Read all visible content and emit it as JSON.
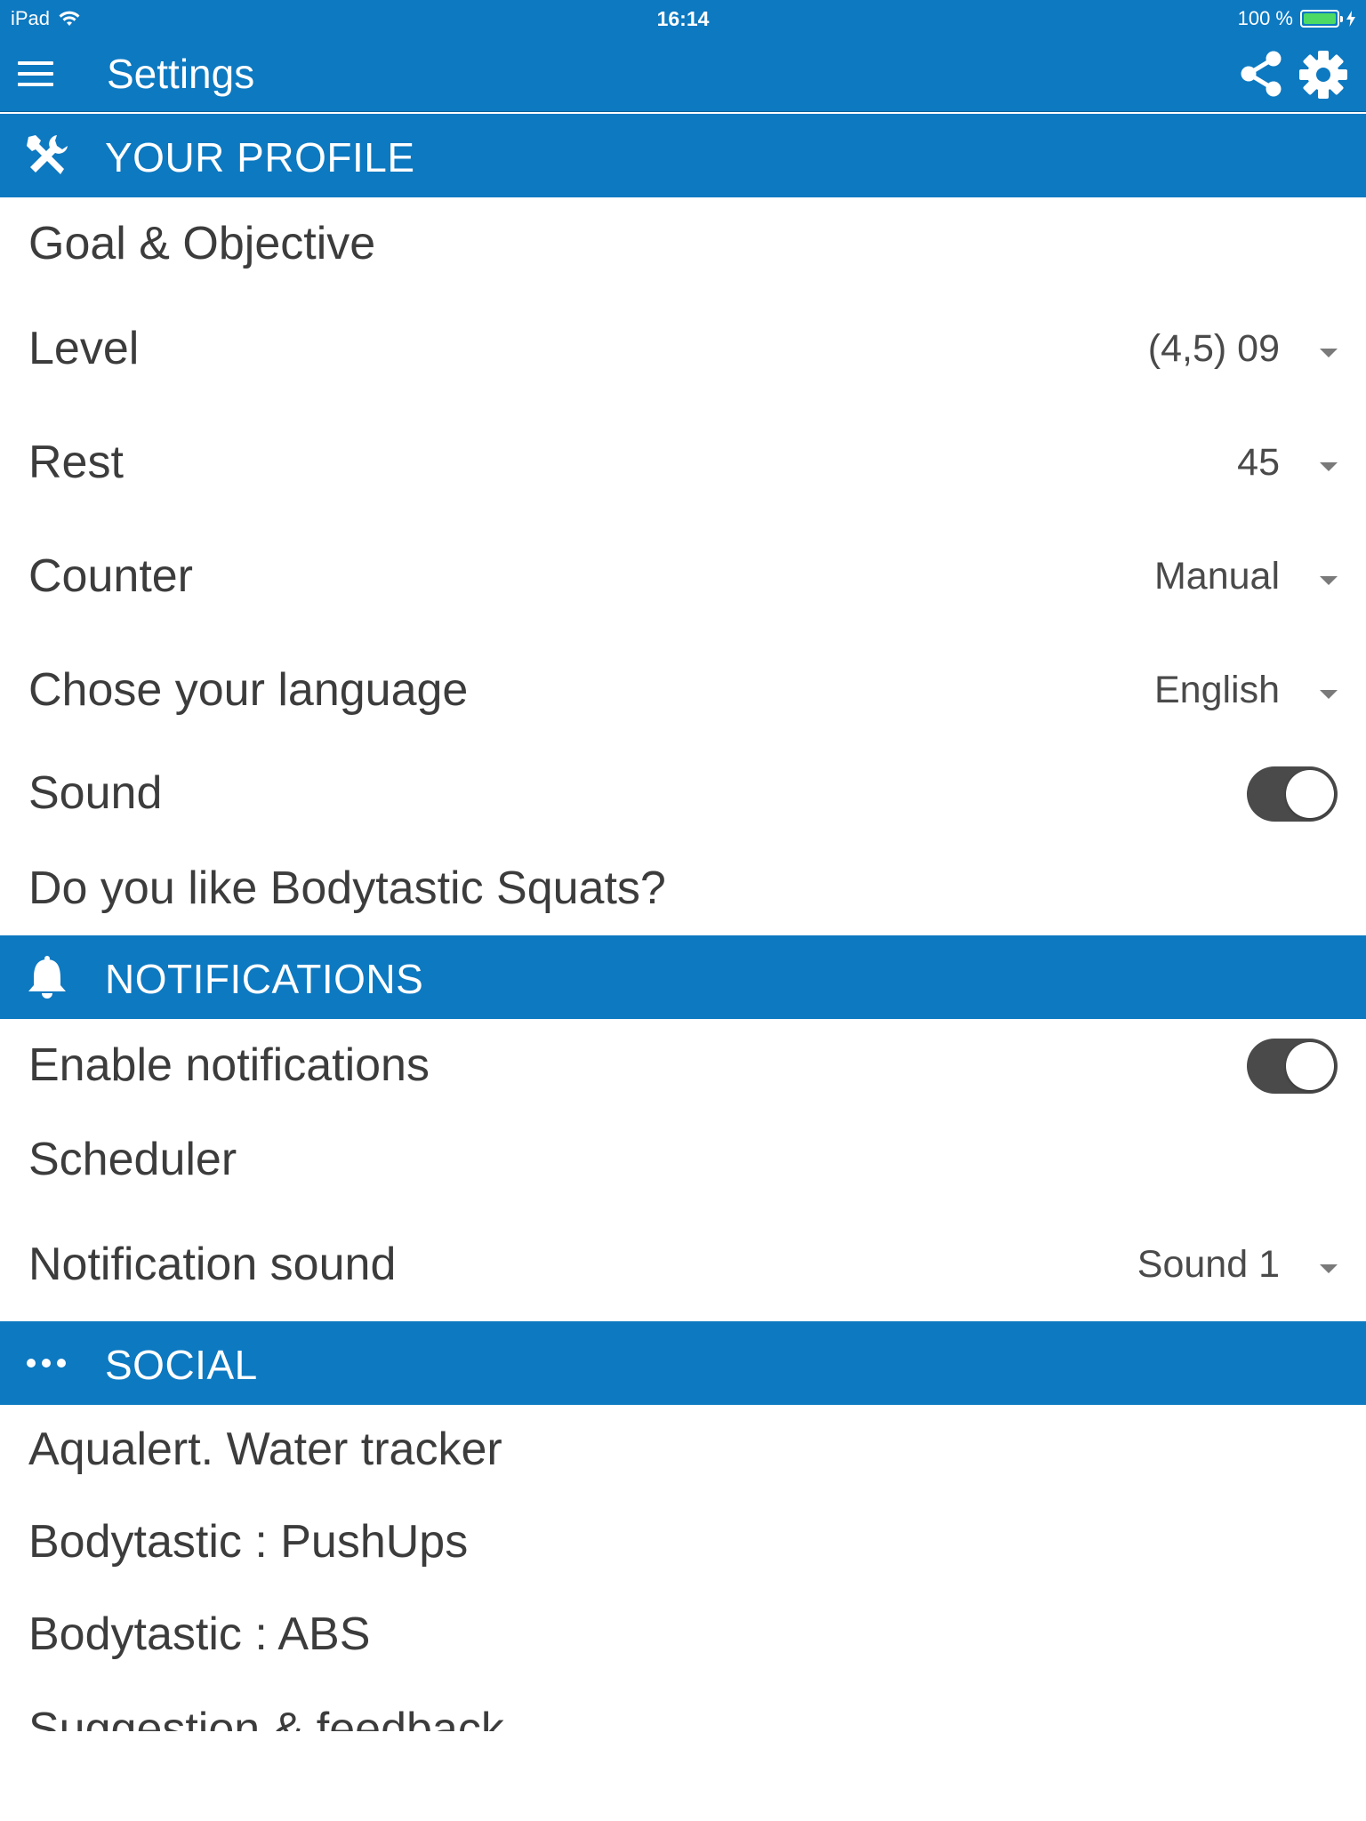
{
  "status_bar": {
    "device": "iPad",
    "time": "16:14",
    "battery": "100 %",
    "battery_level": 1.0
  },
  "app_bar": {
    "title": "Settings",
    "icons": [
      "menu-icon",
      "share-icon",
      "gear-icon"
    ]
  },
  "colors": {
    "primary": "#0d79c1",
    "toggle_on": "#4a4a4a",
    "text": "#3c3c3c"
  },
  "profile": {
    "header": "YOUR PROFILE",
    "icon": "tools-icon",
    "goal": "Goal & Objective",
    "level_label": "Level",
    "level_value": "(4,5) 09",
    "rest_label": "Rest",
    "rest_value": "45",
    "counter_label": "Counter",
    "counter_value": "Manual",
    "language_label": "Chose your language",
    "language_value": "English",
    "sound_label": "Sound",
    "sound_on": true,
    "like_label": "Do you like Bodytastic Squats?"
  },
  "notifications": {
    "header": "NOTIFICATIONS",
    "icon": "bell-icon",
    "enable_label": "Enable notifications",
    "enable_on": true,
    "scheduler_label": "Scheduler",
    "sound_label": "Notification sound",
    "sound_value": "Sound 1"
  },
  "social": {
    "header": "SOCIAL",
    "icon": "more-dots-icon",
    "items": [
      "Aqualert. Water tracker",
      "Bodytastic : PushUps",
      "Bodytastic : ABS",
      "Suggestion & feedback"
    ]
  }
}
